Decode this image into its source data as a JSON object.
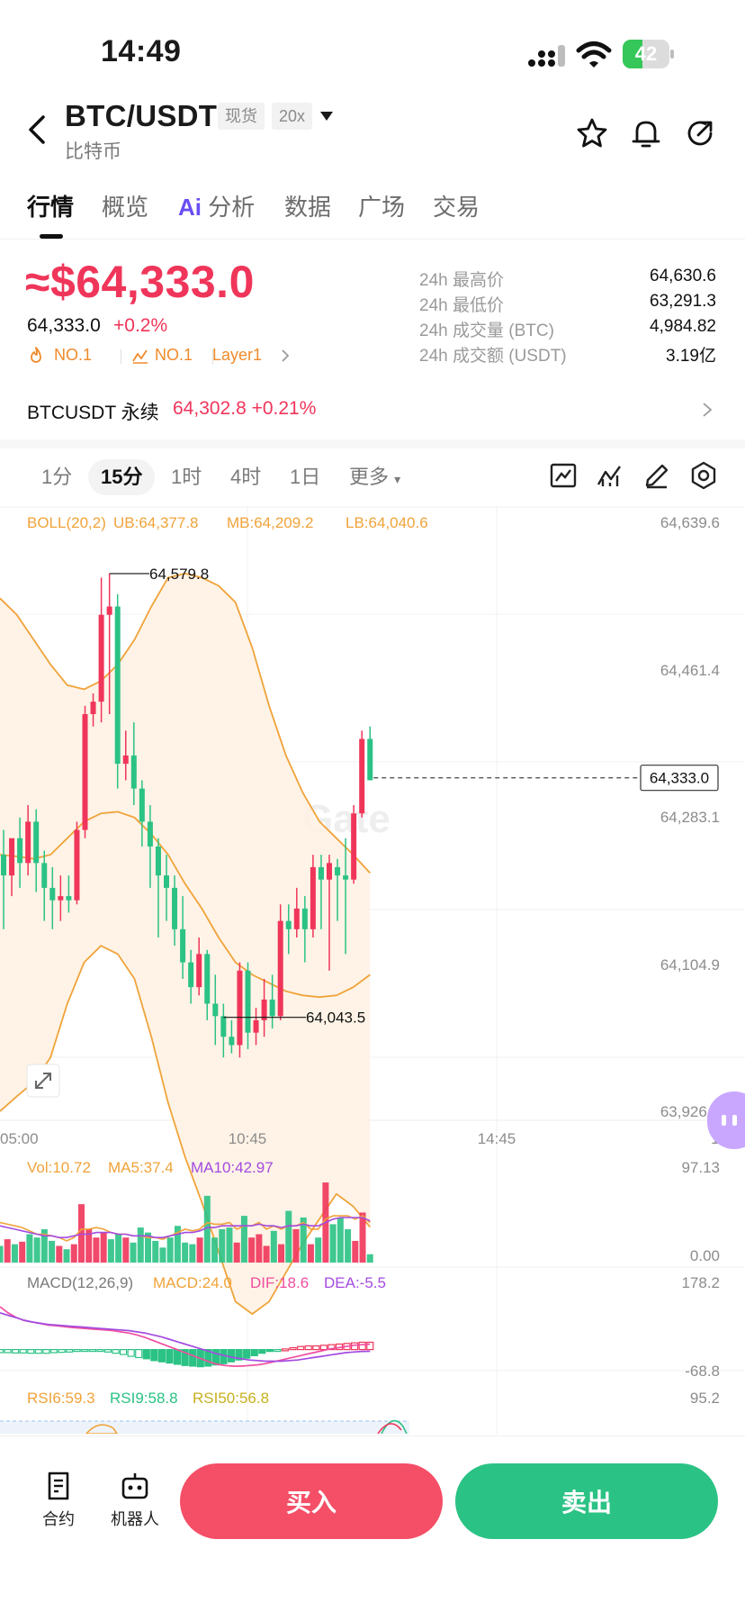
{
  "status_bar": {
    "time": "14:49",
    "battery": "42",
    "battery_level": 0.42
  },
  "header": {
    "title": "BTC/USDT",
    "subtitle": "比特币",
    "spot_tag": "现货",
    "leverage_tag": "20x"
  },
  "tabs": [
    {
      "label": "行情",
      "active": true
    },
    {
      "label": "概览"
    },
    {
      "label": "分析",
      "prefix": "Ai"
    },
    {
      "label": "数据"
    },
    {
      "label": "广场"
    },
    {
      "label": "交易"
    }
  ],
  "price": {
    "big": "≈$64,333.0",
    "last": "64,333.0",
    "change": "+0.2%",
    "rank1": "NO.1",
    "rank2": "NO.1",
    "category": "Layer1"
  },
  "stats": [
    {
      "label": "24h 最高价",
      "value": "64,630.6"
    },
    {
      "label": "24h 最低价",
      "value": "63,291.3"
    },
    {
      "label": "24h 成交量 (BTC)",
      "value": "4,984.82"
    },
    {
      "label": "24h 成交额 (USDT)",
      "value": "3.19亿"
    }
  ],
  "perpetual": {
    "name": "BTCUSDT 永续",
    "price": "64,302.8",
    "change": "+0.21%"
  },
  "timeframes": [
    {
      "label": "1分"
    },
    {
      "label": "15分",
      "active": true
    },
    {
      "label": "1时"
    },
    {
      "label": "4时"
    },
    {
      "label": "1日"
    },
    {
      "label": "更多"
    }
  ],
  "chart_data": {
    "type": "candlestick",
    "title": "",
    "interval": "15分",
    "boll": {
      "label": "BOLL(20,2)",
      "ub": "UB:64,377.8",
      "mb": "MB:64,209.2",
      "lb": "LB:64,040.6"
    },
    "y_axis_labels": [
      "64,639.6",
      "64,461.4",
      "64,283.1",
      "64,104.9",
      "63,926.7"
    ],
    "ylim": [
      63926.7,
      64639.6
    ],
    "x_axis_labels": [
      "05:00",
      "10:45",
      "14:45",
      "14:45"
    ],
    "current_price_label": "64,333.0",
    "current_price": 64333.0,
    "high_marker": "64,579.8",
    "high_value": 64579.8,
    "low_marker": "64,043.5",
    "low_value": 64043.5,
    "watermark": "Gate",
    "candles": [
      {
        "o": 64240,
        "h": 64270,
        "c": 64215,
        "l": 64150
      },
      {
        "o": 64215,
        "h": 64250,
        "c": 64260,
        "l": 64190
      },
      {
        "o": 64260,
        "h": 64285,
        "c": 64230,
        "l": 64200
      },
      {
        "o": 64230,
        "h": 64300,
        "c": 64280,
        "l": 64215
      },
      {
        "o": 64280,
        "h": 64295,
        "c": 64230,
        "l": 64195
      },
      {
        "o": 64230,
        "h": 64245,
        "c": 64200,
        "l": 64160
      },
      {
        "o": 64200,
        "h": 64225,
        "c": 64185,
        "l": 64150
      },
      {
        "o": 64185,
        "h": 64215,
        "c": 64190,
        "l": 64160
      },
      {
        "o": 64190,
        "h": 64215,
        "c": 64185,
        "l": 64170
      },
      {
        "o": 64185,
        "h": 64280,
        "c": 64270,
        "l": 64180
      },
      {
        "o": 64270,
        "h": 64420,
        "c": 64410,
        "l": 64260
      },
      {
        "o": 64410,
        "h": 64435,
        "c": 64425,
        "l": 64395
      },
      {
        "o": 64425,
        "h": 64575,
        "c": 64530,
        "l": 64400
      },
      {
        "o": 64530,
        "h": 64580,
        "c": 64540,
        "l": 64410
      },
      {
        "o": 64540,
        "h": 64555,
        "c": 64350,
        "l": 64320
      },
      {
        "o": 64350,
        "h": 64390,
        "c": 64360,
        "l": 64330
      },
      {
        "o": 64360,
        "h": 64400,
        "c": 64320,
        "l": 64300
      },
      {
        "o": 64320,
        "h": 64330,
        "c": 64280,
        "l": 64250
      },
      {
        "o": 64280,
        "h": 64300,
        "c": 64250,
        "l": 64200
      },
      {
        "o": 64250,
        "h": 64260,
        "c": 64215,
        "l": 64140
      },
      {
        "o": 64215,
        "h": 64240,
        "c": 64200,
        "l": 64160
      },
      {
        "o": 64200,
        "h": 64215,
        "c": 64150,
        "l": 64130
      },
      {
        "o": 64150,
        "h": 64190,
        "c": 64110,
        "l": 64090
      },
      {
        "o": 64110,
        "h": 64125,
        "c": 64080,
        "l": 64060
      },
      {
        "o": 64080,
        "h": 64140,
        "c": 64120,
        "l": 64070
      },
      {
        "o": 64120,
        "h": 64125,
        "c": 64060,
        "l": 64040
      },
      {
        "o": 64060,
        "h": 64095,
        "c": 64045,
        "l": 64010
      },
      {
        "o": 64045,
        "h": 64060,
        "c": 64020,
        "l": 63995
      },
      {
        "o": 64020,
        "h": 64040,
        "c": 64010,
        "l": 64000
      },
      {
        "o": 64010,
        "h": 64110,
        "c": 64100,
        "l": 63995
      },
      {
        "o": 64100,
        "h": 64110,
        "c": 64025,
        "l": 64005
      },
      {
        "o": 64025,
        "h": 64055,
        "c": 64040,
        "l": 64010
      },
      {
        "o": 64040,
        "h": 64090,
        "c": 64065,
        "l": 64020
      },
      {
        "o": 64065,
        "h": 64095,
        "c": 64045,
        "l": 64030
      },
      {
        "o": 64045,
        "h": 64180,
        "c": 64160,
        "l": 64040
      },
      {
        "o": 64160,
        "h": 64180,
        "c": 64150,
        "l": 64120
      },
      {
        "o": 64150,
        "h": 64200,
        "c": 64175,
        "l": 64140
      },
      {
        "o": 64175,
        "h": 64190,
        "c": 64150,
        "l": 64110
      },
      {
        "o": 64150,
        "h": 64240,
        "c": 64225,
        "l": 64140
      },
      {
        "o": 64225,
        "h": 64240,
        "c": 64210,
        "l": 64150
      },
      {
        "o": 64210,
        "h": 64240,
        "c": 64230,
        "l": 64100
      },
      {
        "o": 64225,
        "h": 64235,
        "c": 64215,
        "l": 64160
      },
      {
        "o": 64215,
        "h": 64260,
        "c": 64210,
        "l": 64120
      },
      {
        "o": 64210,
        "h": 64300,
        "c": 64290,
        "l": 64205
      },
      {
        "o": 64290,
        "h": 64390,
        "c": 64380,
        "l": 64285
      },
      {
        "o": 64380,
        "h": 64395,
        "c": 64330,
        "l": 64330
      }
    ],
    "boll_upper": [
      64550,
      64530,
      64500,
      64470,
      64445,
      64440,
      64450,
      64470,
      64500,
      64540,
      64575,
      64580,
      64575,
      64565,
      64545,
      64490,
      64420,
      64360,
      64315,
      64280,
      64260,
      64240,
      64218
    ],
    "boll_mid": [
      64240,
      64238,
      64235,
      64240,
      64260,
      64280,
      64290,
      64292,
      64285,
      64265,
      64240,
      64205,
      64175,
      64140,
      64110,
      64095,
      64085,
      64075,
      64070,
      64068,
      64070,
      64080,
      64095
    ],
    "boll_lower": [
      63930,
      63948,
      63965,
      63995,
      64060,
      64110,
      64130,
      64120,
      64090,
      64020,
      63940,
      63875,
      63820,
      63760,
      63700,
      63685,
      63700,
      63735,
      63770,
      63800,
      63830,
      63815,
      63790
    ],
    "volume": {
      "label_vol": "Vol:10.72",
      "label_ma5": "MA5:37.4",
      "label_ma10": "MA10:42.97",
      "max_label": "97.13",
      "min_label": "0.00",
      "ymax": 97.13,
      "bars": [
        20,
        28,
        22,
        25,
        34,
        30,
        40,
        26,
        20,
        16,
        22,
        70,
        40,
        30,
        36,
        28,
        34,
        30,
        24,
        42,
        36,
        26,
        18,
        30,
        44,
        24,
        22,
        30,
        80,
        30,
        40,
        42,
        24,
        56,
        30,
        34,
        20,
        38,
        22,
        62,
        40,
        54,
        22,
        30,
        96,
        46,
        54,
        40,
        26,
        60,
        10
      ],
      "ma5": [
        48,
        46,
        44,
        42,
        38,
        34,
        34,
        32,
        30,
        26,
        30,
        40,
        40,
        42,
        40,
        36,
        34,
        34,
        32,
        32,
        30,
        30,
        28,
        32,
        36,
        40,
        38,
        40,
        48,
        46,
        46,
        48,
        40,
        44,
        44,
        48,
        40,
        44,
        40,
        44,
        44,
        48,
        40,
        40,
        52,
        56,
        56,
        56,
        52,
        56,
        48
      ],
      "ma10": [
        44,
        42,
        40,
        38,
        36,
        34,
        32,
        32,
        30,
        30,
        32,
        34,
        34,
        36,
        36,
        36,
        34,
        34,
        32,
        32,
        32,
        30,
        30,
        32,
        34,
        36,
        36,
        38,
        42,
        42,
        44,
        44,
        44,
        44,
        44,
        46,
        44,
        44,
        42,
        44,
        44,
        46,
        44,
        44,
        48,
        52,
        54,
        54,
        54,
        54,
        50
      ]
    },
    "macd": {
      "label": "MACD(12,26,9)",
      "label_macd": "MACD:24.0",
      "label_dif": "DIF:18.6",
      "label_dea": "DEA:-5.5",
      "max_label": "178.2",
      "min_label": "-68.8",
      "ymax": 178.2,
      "ymin": -68.8,
      "hist": [
        -10,
        -10,
        -11,
        -11,
        -12,
        -12,
        -12,
        -10,
        -9,
        -8,
        -6,
        -4,
        -3,
        -5,
        -8,
        -12,
        -16,
        -22,
        -26,
        -30,
        -36,
        -40,
        -44,
        -48,
        -52,
        -54,
        -56,
        -54,
        -50,
        -46,
        -40,
        -34,
        -28,
        -20,
        -12,
        -6,
        -2,
        2,
        6,
        10,
        12,
        12,
        14,
        16,
        18,
        20,
        22,
        24,
        24
      ],
      "dif": [
        140,
        120,
        105,
        95,
        90,
        85,
        80,
        78,
        75,
        72,
        70,
        68,
        66,
        64,
        62,
        58,
        54,
        48,
        40,
        30,
        20,
        10,
        0,
        -10,
        -20,
        -30,
        -40,
        -48,
        -52,
        -54,
        -54,
        -52,
        -50,
        -46,
        -40,
        -34,
        -28,
        -22,
        -16,
        -10,
        -4,
        2,
        6,
        10,
        14,
        16,
        18
      ],
      "dea": [
        120,
        112,
        104,
        96,
        90,
        86,
        82,
        80,
        78,
        76,
        74,
        72,
        70,
        68,
        66,
        64,
        62,
        58,
        54,
        48,
        42,
        34,
        26,
        18,
        10,
        2,
        -6,
        -14,
        -20,
        -26,
        -30,
        -34,
        -36,
        -38,
        -38,
        -38,
        -36,
        -34,
        -30,
        -26,
        -22,
        -18,
        -14,
        -10,
        -8,
        -6,
        -5.5
      ]
    },
    "rsi": {
      "label_rsi6": "RSI6:59.3",
      "label_rsi9": "RSI9:58.8",
      "label_rsi50": "RSI50:56.8",
      "max_label": "95.2"
    }
  },
  "colors": {
    "up": "#f0355a",
    "down": "#2bc285",
    "boll": "#f0a33a",
    "ma10": "#a44be0",
    "dif": "#f04ea0",
    "dea": "#a44be0"
  },
  "bottom": {
    "contract": "合约",
    "robot": "机器人",
    "buy": "买入",
    "sell": "卖出"
  }
}
